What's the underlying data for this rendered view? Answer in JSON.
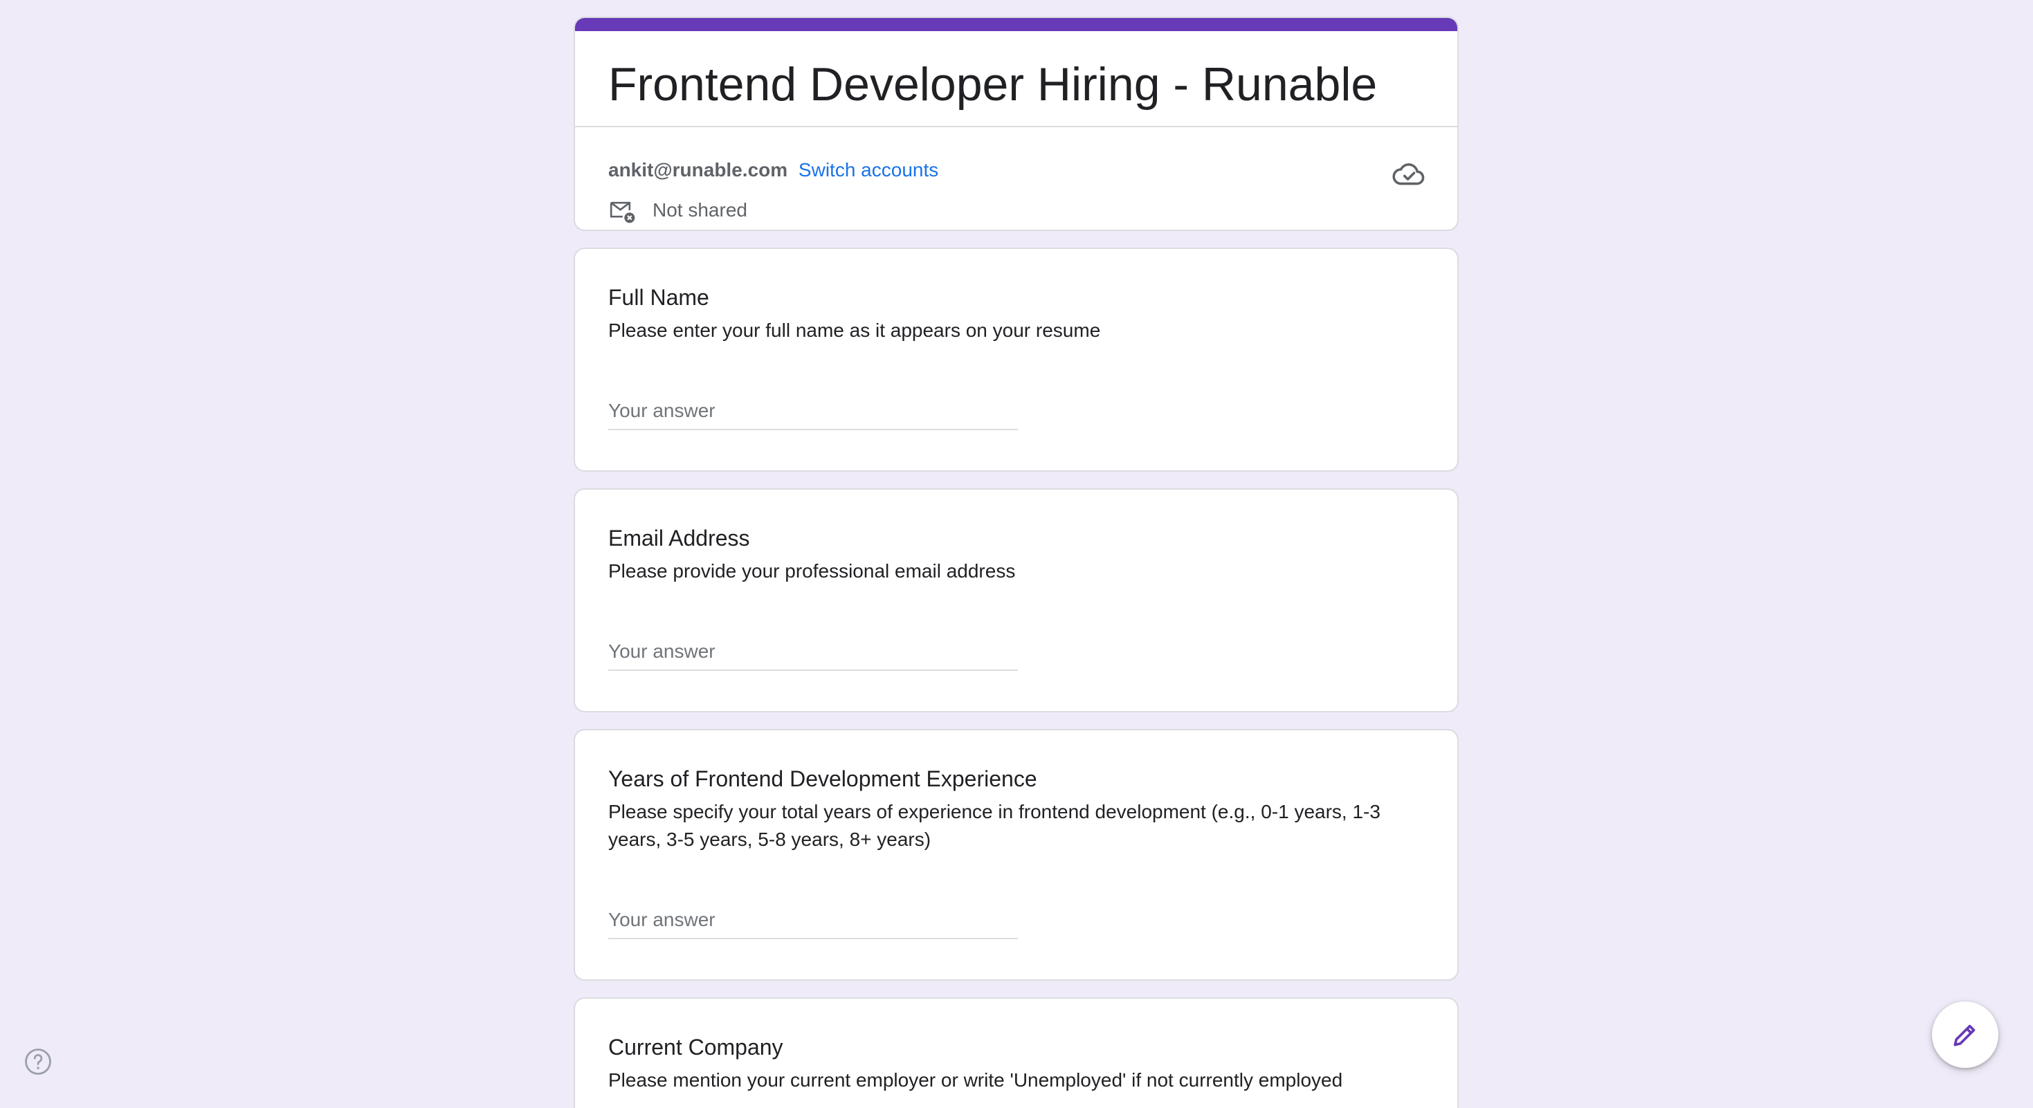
{
  "form": {
    "title": "Frontend Developer Hiring - Runable",
    "accent_color": "#673ab7",
    "background_color": "#f0ebf8"
  },
  "account": {
    "email": "ankit@runable.com",
    "switch_label": "Switch accounts",
    "shared_status": "Not shared",
    "shared_icon": "mail-not-shared-icon",
    "save_status_icon": "cloud-done-icon"
  },
  "questions": [
    {
      "title": "Full Name",
      "description": "Please enter your full name as it appears on your resume",
      "placeholder": "Your answer"
    },
    {
      "title": "Email Address",
      "description": "Please provide your professional email address",
      "placeholder": "Your answer"
    },
    {
      "title": "Years of Frontend Development Experience",
      "description": "Please specify your total years of experience in frontend development (e.g., 0-1 years, 1-3 years, 3-5 years, 5-8 years, 8+ years)",
      "placeholder": "Your answer"
    },
    {
      "title": "Current Company",
      "description": "Please mention your current employer or write 'Unemployed' if not currently employed"
    }
  ],
  "floating": {
    "edit_icon": "pencil-icon",
    "help_icon": "help-circle-icon"
  }
}
